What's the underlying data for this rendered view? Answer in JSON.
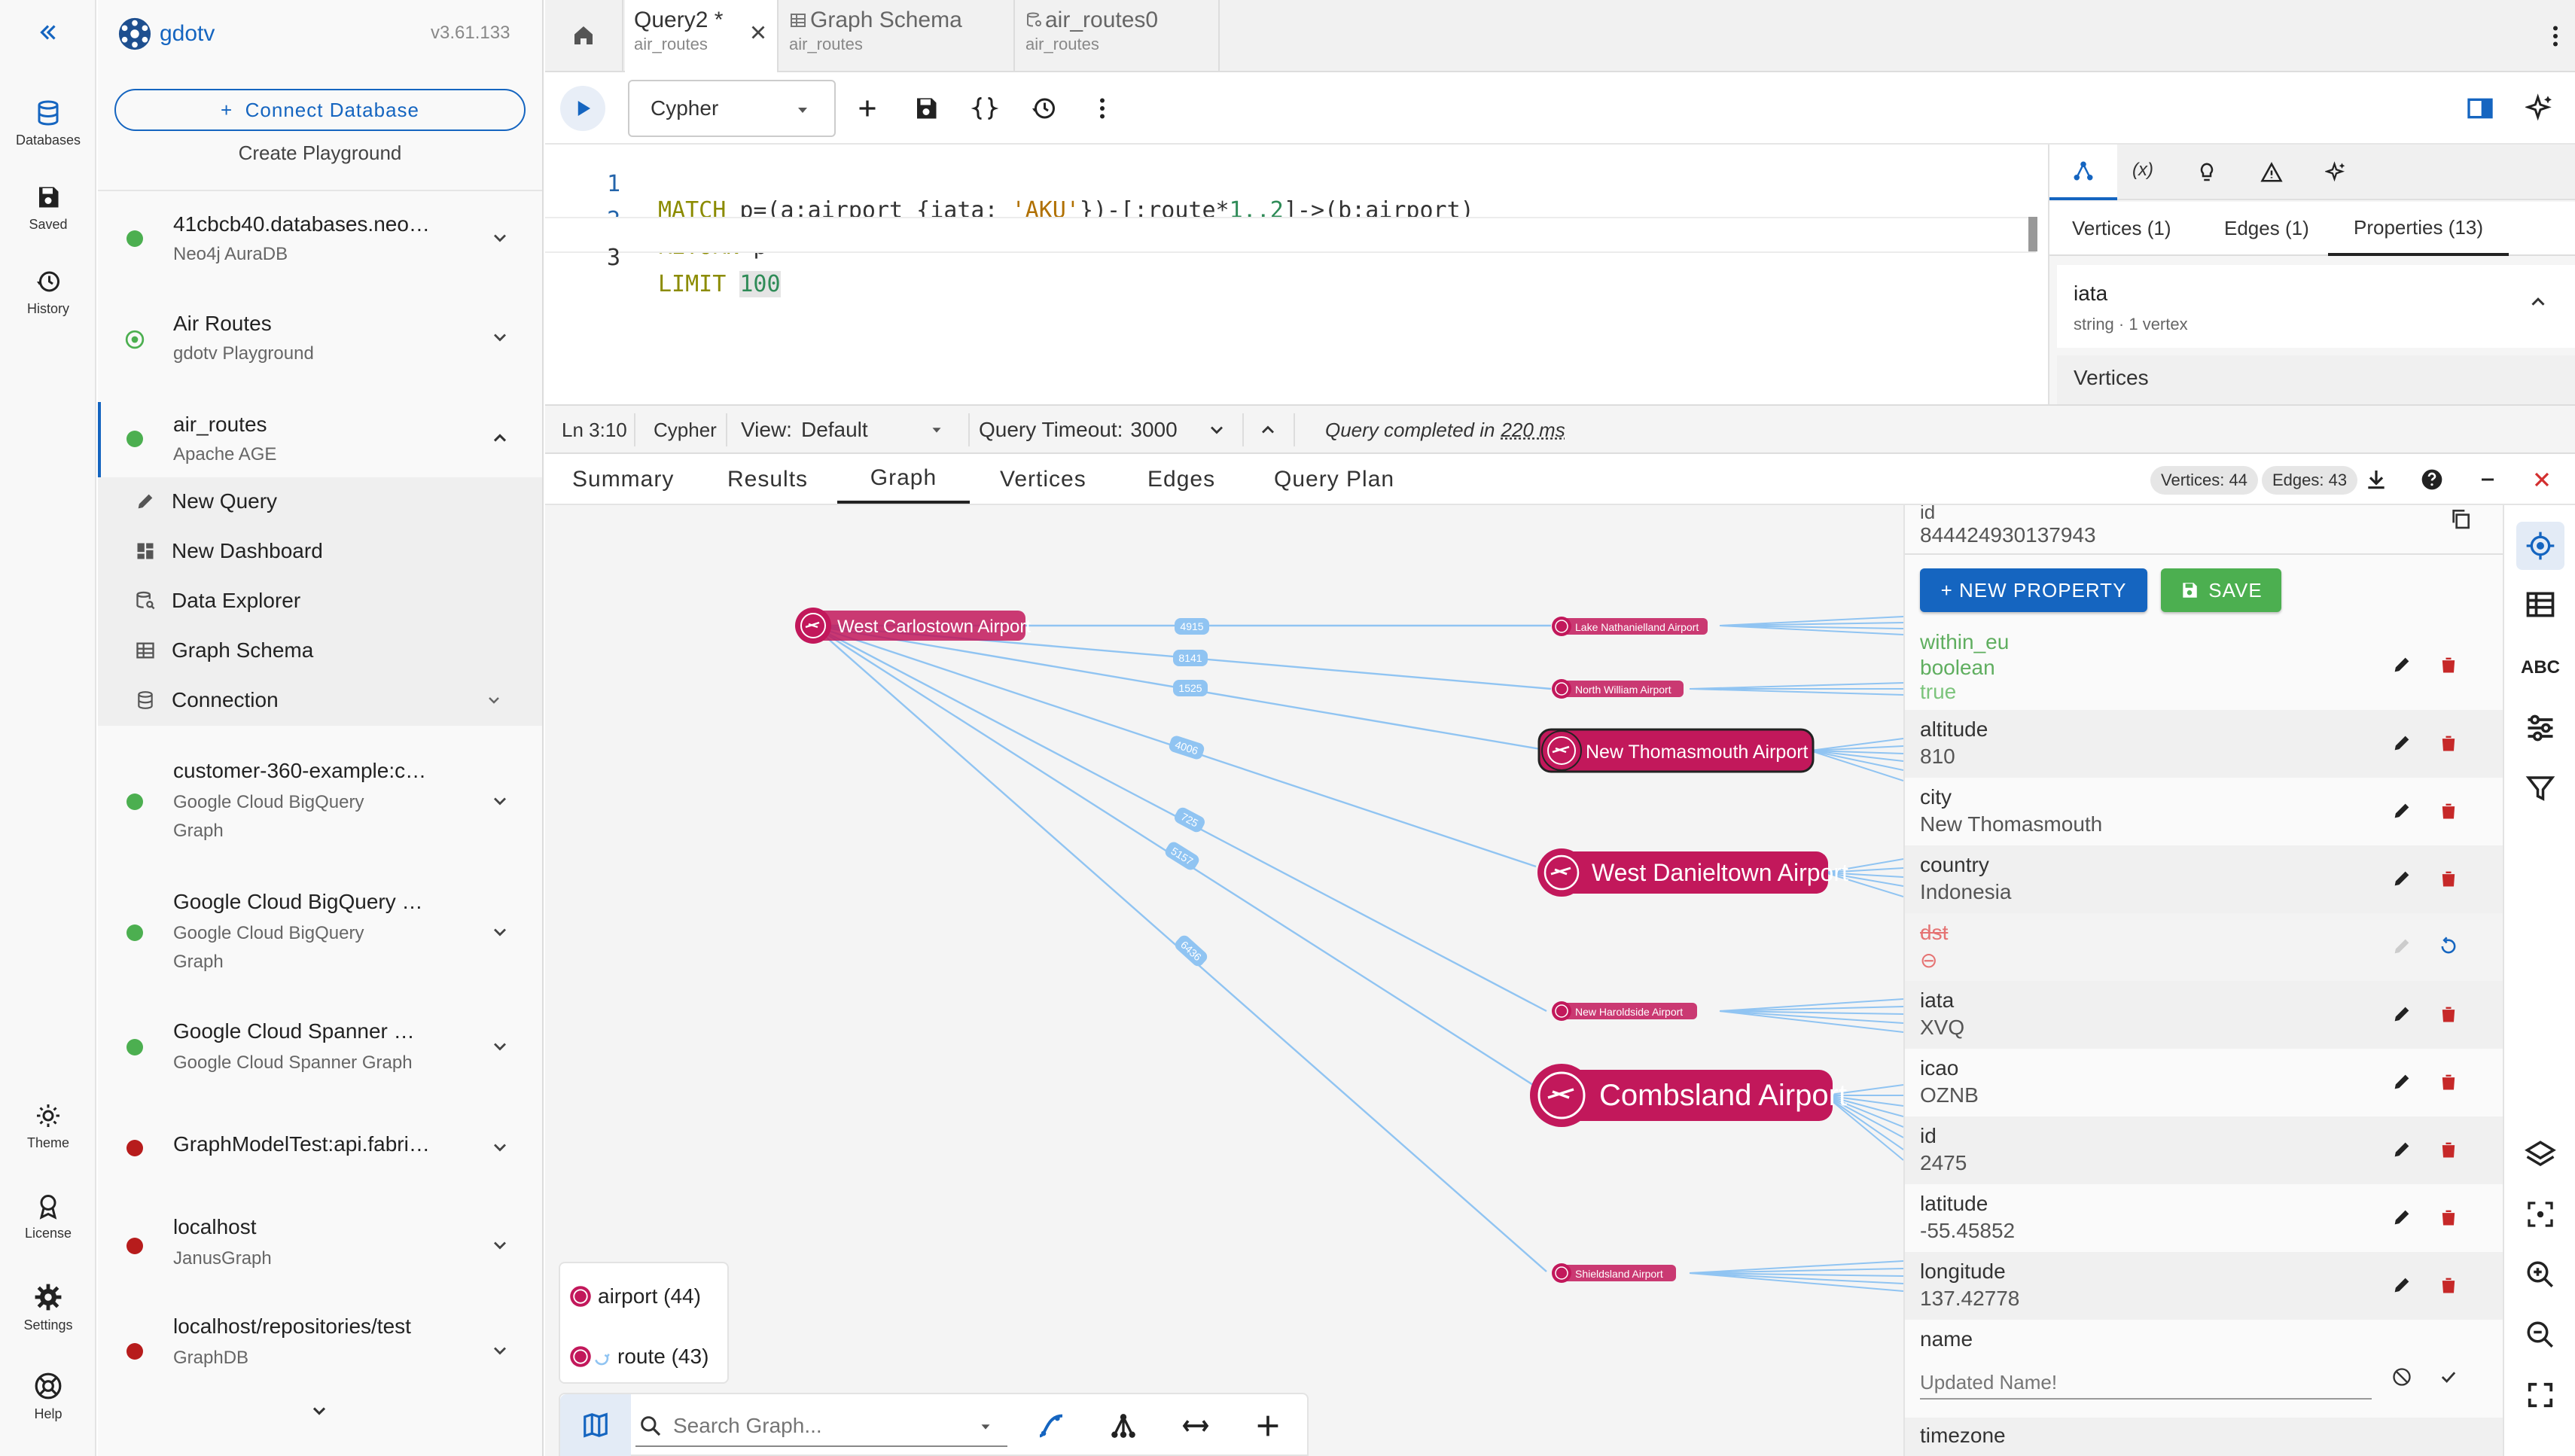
{
  "rail": {
    "databases": "Databases",
    "saved": "Saved",
    "history": "History",
    "theme": "Theme",
    "license": "License",
    "settings": "Settings",
    "help": "Help"
  },
  "sidebar": {
    "app_name": "gdotv",
    "version": "v3.61.133",
    "connect_label": "+  Connect Database",
    "playground_label": "Create Playground",
    "connections": [
      {
        "title": "41cbcb40.databases.neo…",
        "sub": "Neo4j AuraDB",
        "sub2": "",
        "status": "#4caf50"
      },
      {
        "title": "Air Routes",
        "sub": "gdotv Playground",
        "sub2": "",
        "status": "#4caf50"
      },
      {
        "title": "air_routes",
        "sub": "Apache AGE",
        "sub2": "",
        "status": "#4caf50"
      },
      {
        "title": "customer-360-example:c…",
        "sub": "Google Cloud BigQuery",
        "sub2": "Graph",
        "status": "#4caf50"
      },
      {
        "title": "Google Cloud BigQuery …",
        "sub": "Google Cloud BigQuery",
        "sub2": "Graph",
        "status": "#4caf50"
      },
      {
        "title": "Google Cloud Spanner …",
        "sub": "Google Cloud Spanner Graph",
        "sub2": "",
        "status": "#4caf50"
      },
      {
        "title": "GraphModelTest:api.fabri…",
        "sub": "",
        "sub2": "",
        "status": "#b71c1c"
      },
      {
        "title": "localhost",
        "sub": "JanusGraph",
        "sub2": "",
        "status": "#b71c1c"
      },
      {
        "title": "localhost/repositories/test",
        "sub": "GraphDB",
        "sub2": "",
        "status": "#b71c1c"
      }
    ],
    "sub_items": {
      "new_query": "New Query",
      "new_dashboard": "New Dashboard",
      "data_explorer": "Data Explorer",
      "graph_schema": "Graph Schema",
      "connection": "Connection"
    }
  },
  "tabs": [
    {
      "title": "Query2 *",
      "sub": "air_routes"
    },
    {
      "title": "Graph Schema",
      "sub": "air_routes"
    },
    {
      "title": "air_routes0",
      "sub": "air_routes"
    }
  ],
  "toolbar": {
    "language": "Cypher"
  },
  "editor": {
    "line1": {
      "n": "1",
      "kw": "MATCH",
      "rest": " p=(a:airport {iata: ",
      "str": "'AKU'",
      "rest2": "})-[:route*",
      "num": "1..2",
      "rest3": "]->(b:airport)"
    },
    "line2": {
      "n": "2",
      "kw": "RETURN",
      "rest": " p"
    },
    "line3": {
      "n": "3",
      "kw": "LIMIT",
      "num": "100"
    }
  },
  "rpanel": {
    "tabs": [
      "Vertices (1)",
      "Edges (1)",
      "Properties (13)"
    ],
    "prop_name": "iata",
    "prop_meta": "string · 1 vertex",
    "section": "Vertices"
  },
  "status": {
    "pos": "Ln 3:10",
    "lang": "Cypher",
    "view_label": "View:",
    "view_value": "Default",
    "timeout_label": "Query Timeout:",
    "timeout_value": "3000",
    "completed_prefix": "Query completed in",
    "completed_time": "220 ms"
  },
  "result_tabs": [
    "Summary",
    "Results",
    "Graph",
    "Vertices",
    "Edges",
    "Query Plan"
  ],
  "counts": {
    "vertices": "Vertices: 44",
    "edges": "Edges: 43"
  },
  "graph": {
    "nodes": [
      {
        "label": "West Carlostown Airport",
        "size": "m"
      },
      {
        "label": "Lake Nathanielland Airport",
        "size": "s"
      },
      {
        "label": "North William Airport",
        "size": "s"
      },
      {
        "label": "New Thomasmouth Airport",
        "size": "l"
      },
      {
        "label": "West Danieltown Airport",
        "size": "xl"
      },
      {
        "label": "New Haroldside Airport",
        "size": "s"
      },
      {
        "label": "Combsland Airport",
        "size": "xxl"
      },
      {
        "label": "Shieldsland Airport",
        "size": "s"
      }
    ],
    "edge_labels": [
      "4915",
      "8141",
      "1525",
      "4006",
      "725",
      "5157",
      "6436"
    ]
  },
  "legend": {
    "airport": "airport (44)",
    "route": "route (43)"
  },
  "search": {
    "placeholder": "Search Graph..."
  },
  "props": {
    "top_key": "id",
    "top_value": "844424930137943",
    "new_property": "+ NEW PROPERTY",
    "save": "SAVE",
    "within_eu": {
      "key": "within_eu",
      "type": "boolean",
      "value": "true"
    },
    "rows": [
      {
        "key": "altitude",
        "value": "810"
      },
      {
        "key": "city",
        "value": "New Thomasmouth"
      },
      {
        "key": "country",
        "value": "Indonesia"
      },
      {
        "key": "iata",
        "value": "XVQ"
      },
      {
        "key": "icao",
        "value": "OZNB"
      },
      {
        "key": "id",
        "value": "2475"
      },
      {
        "key": "latitude",
        "value": "-55.45852"
      },
      {
        "key": "longitude",
        "value": "137.42778"
      }
    ],
    "dst": {
      "key": "dst",
      "value": "⊖"
    },
    "name_key": "name",
    "name_placeholder": "Updated Name!",
    "timezone_key": "timezone"
  },
  "colors": {
    "accent": "#1565c0",
    "node": "#c2185b",
    "edge": "#90c4f2",
    "save": "#4caf50",
    "delete": "#c62828"
  }
}
